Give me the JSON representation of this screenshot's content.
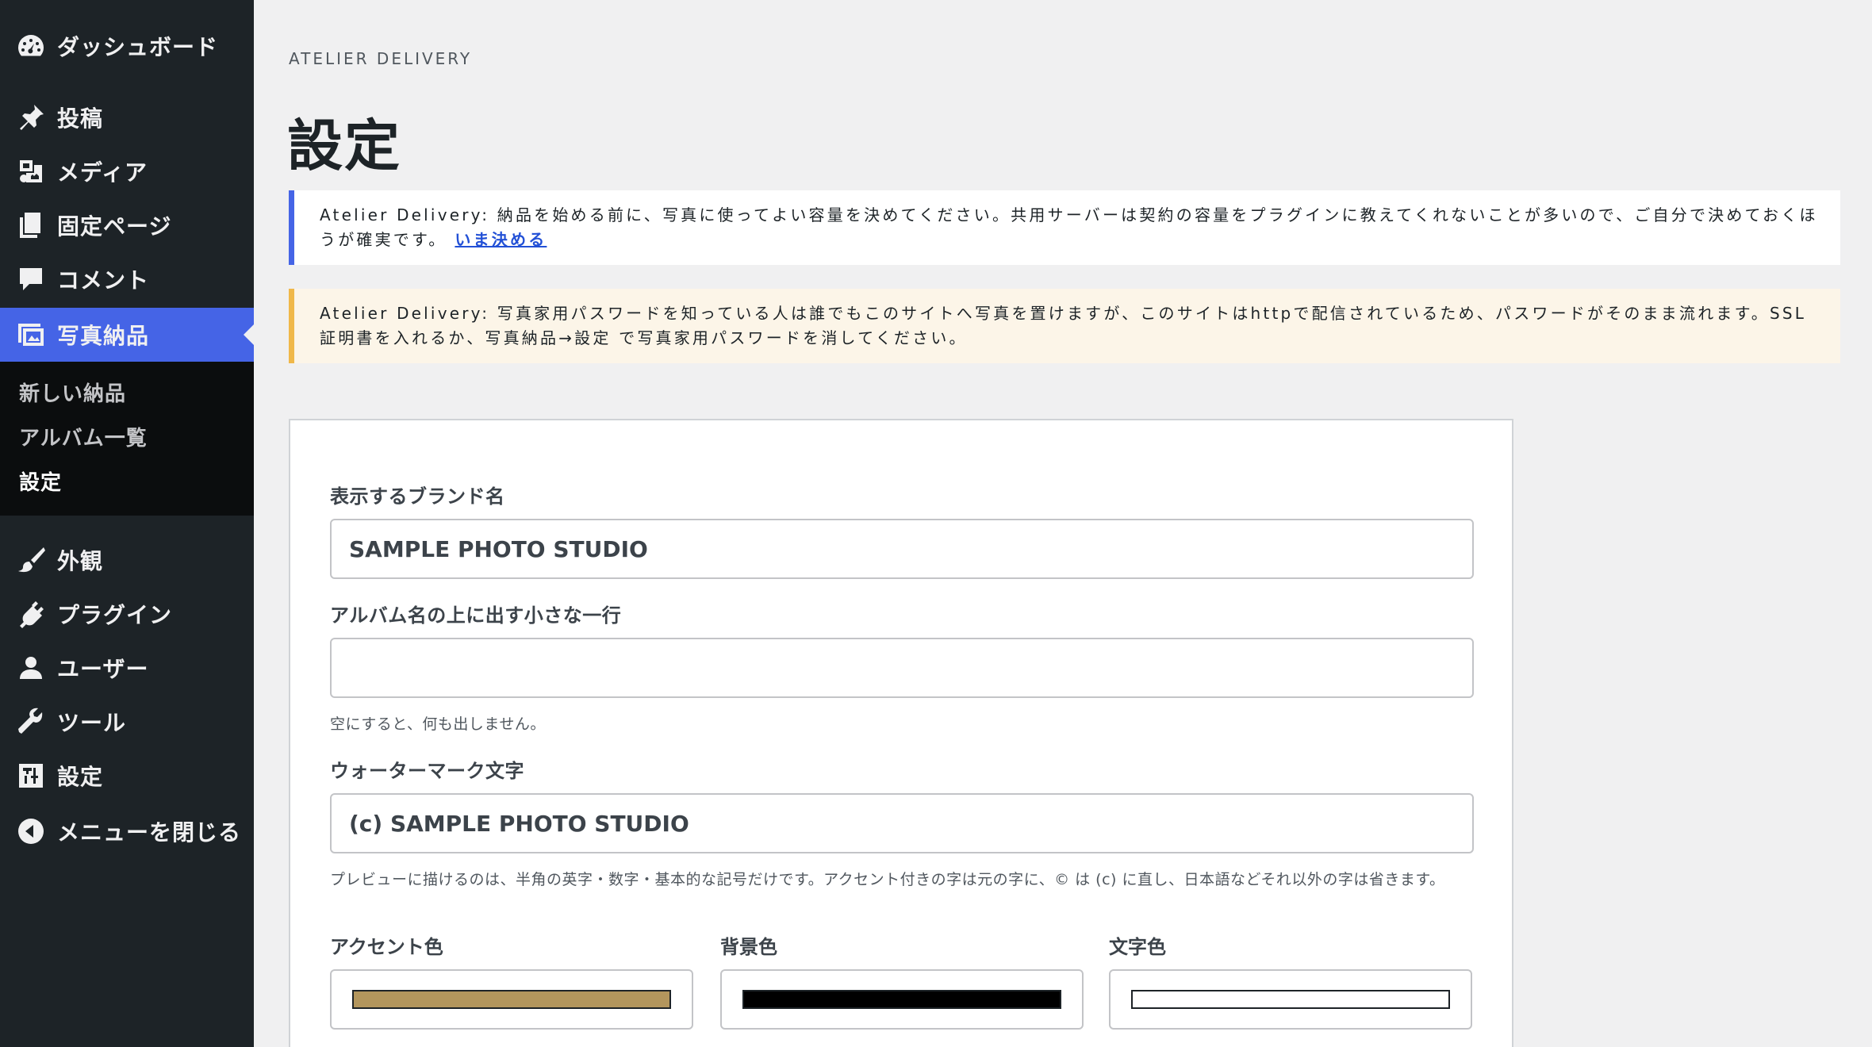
{
  "sidebar": {
    "menu": [
      {
        "label": "ダッシュボード",
        "icon": "dashboard-icon"
      },
      {
        "label": "投稿",
        "icon": "pin-icon"
      },
      {
        "label": "メディア",
        "icon": "media-icon"
      },
      {
        "label": "固定ページ",
        "icon": "page-icon"
      },
      {
        "label": "コメント",
        "icon": "comment-icon"
      },
      {
        "label": "写真納品",
        "icon": "photo-delivery-icon"
      },
      {
        "label": "外観",
        "icon": "brush-icon"
      },
      {
        "label": "プラグイン",
        "icon": "plug-icon"
      },
      {
        "label": "ユーザー",
        "icon": "user-icon"
      },
      {
        "label": "ツール",
        "icon": "wrench-icon"
      },
      {
        "label": "設定",
        "icon": "settings-icon"
      },
      {
        "label": "メニューを閉じる",
        "icon": "collapse-icon"
      }
    ],
    "submenu": [
      {
        "label": "新しい納品"
      },
      {
        "label": "アルバム一覧"
      },
      {
        "label": "設定"
      }
    ]
  },
  "header": {
    "eyebrow": "ATELIER DELIVERY",
    "title": "設定"
  },
  "notices": {
    "info": {
      "brand": "Atelier Delivery:",
      "text": " 納品を始める前に、写真に使ってよい容量を決めてください。共用サーバーは契約の容量をプラグインに教えてくれないことが多いので、ご自分で決めておくほうが確実です。",
      "link": "いま決める"
    },
    "warning": {
      "brand": "Atelier Delivery:",
      "text": " 写真家用パスワードを知っている人は誰でもこのサイトへ写真を置けますが、このサイトはhttpで配信されているため、パスワードがそのまま流れます。SSL証明書を入れるか、写真納品→設定 で写真家用パスワードを消してください。"
    }
  },
  "form": {
    "brand_name": {
      "label": "表示するブランド名",
      "value": "SAMPLE PHOTO STUDIO"
    },
    "tagline": {
      "label": "アルバム名の上に出す小さな一行",
      "value": "",
      "help": "空にすると、何も出しません。"
    },
    "watermark": {
      "label": "ウォーターマーク文字",
      "value": "(c) SAMPLE PHOTO STUDIO",
      "help": "プレビューに描けるのは、半角の英字・数字・基本的な記号だけです。アクセント付きの字は元の字に、© は (c) に直し、日本語などそれ以外の字は省きます。"
    },
    "colors": {
      "accent": {
        "label": "アクセント色",
        "value": "#b3965d"
      },
      "background": {
        "label": "背景色",
        "value": "#000000"
      },
      "text": {
        "label": "文字色",
        "value": "#ffffff"
      }
    }
  }
}
